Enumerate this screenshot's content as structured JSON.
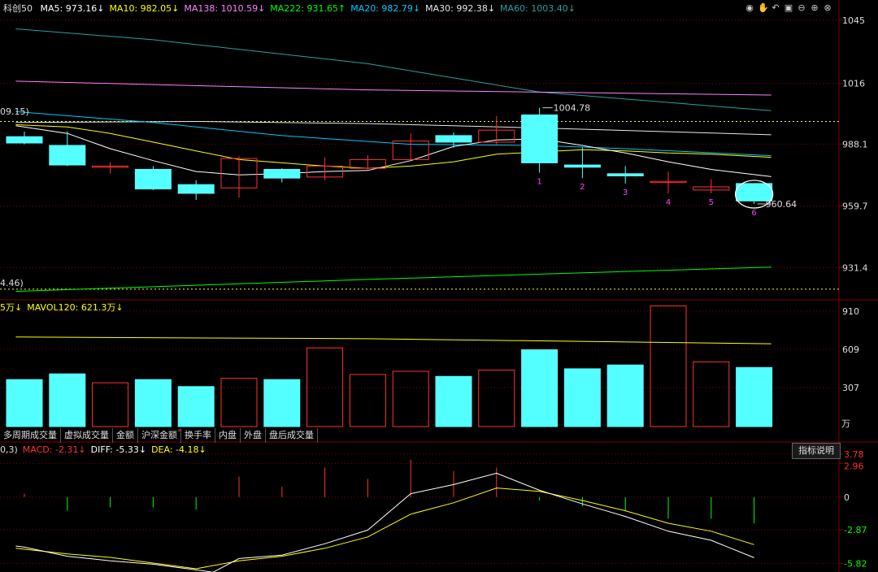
{
  "colors": {
    "up": "#ff3232",
    "down": "#54ffff",
    "ma5": "#ffffff",
    "ma10": "#ffff00",
    "ma138": "#ff80ff",
    "ma222": "#00ff00",
    "ma20": "#00c8ff",
    "ma30": "#e8e8e8",
    "ma60": "#2aa0a0",
    "mavol": "#ffff00",
    "diff": "#ffffff",
    "dea": "#ffff00",
    "grid": "#800000",
    "axis_text": "#dddddd"
  },
  "header": {
    "symbol": "科创50",
    "ma": [
      {
        "label": "MA5: 973.16↓",
        "color": "#ffffff"
      },
      {
        "label": "MA10: 982.05↓",
        "color": "#ffff00"
      },
      {
        "label": "MA138: 1010.59↓",
        "color": "#ff80ff"
      },
      {
        "label": "MA222: 931.65↑",
        "color": "#00ff00"
      },
      {
        "label": "MA20: 982.79↓",
        "color": "#00c8ff"
      },
      {
        "label": "MA30: 992.38↓",
        "color": "#e8e8e8"
      },
      {
        "label": "MA60: 1003.40↓",
        "color": "#2aa0a0"
      }
    ],
    "tool_icons": [
      "eye-icon",
      "hand-icon",
      "undo-icon",
      "lock-icon",
      "minus-icon",
      "plus-icon",
      "close-icon"
    ]
  },
  "price_panel": {
    "axis_ticks": [
      1045,
      1016,
      988.1,
      959.7,
      931.4
    ],
    "axis_labels": [
      "1045",
      "1016",
      "988.1",
      "959.7",
      "931.4"
    ],
    "left_edge_labels": [
      "09.15)",
      "4.46)"
    ],
    "high_marker": "1004.78",
    "low_marker": "960.64",
    "candle_numbers": [
      "1",
      "2",
      "3",
      "4",
      "5",
      "6"
    ]
  },
  "volume_panel": {
    "legend": [
      {
        "label": "5万↓",
        "color": "#ffff00"
      },
      {
        "label": "MAVOL120: 621.3万↓",
        "color": "#ffff00"
      }
    ],
    "axis_labels": [
      "910",
      "609",
      "307",
      "万"
    ]
  },
  "tabs": [
    "多周期成交量",
    "虚拟成交量",
    "金额",
    "沪深金额",
    "换手率",
    "内盘",
    "外盘",
    "盘后成交量"
  ],
  "indicator_button": "指标说明",
  "macd_panel": {
    "legend": [
      {
        "label": "0,3)",
        "color": "#dddddd"
      },
      {
        "label": "MACD: -2.31↓",
        "color": "#ff3232"
      },
      {
        "label": "DIFF: -5.33↓",
        "color": "#ffffff"
      },
      {
        "label": "DEA: -4.18↓",
        "color": "#ffff00"
      }
    ],
    "axis_labels": [
      {
        "text": "3.78",
        "color": "#ff3232",
        "value": 3.78
      },
      {
        "text": "2.96",
        "color": "#ff3232",
        "value": 2.96
      },
      {
        "text": "0",
        "color": "#dddddd",
        "value": 0
      },
      {
        "text": "-2.87",
        "color": "#00ff00",
        "value": -2.87
      },
      {
        "text": "-5.82",
        "color": "#00ff00",
        "value": -5.82
      }
    ]
  },
  "chart_data": {
    "type": "candlestick",
    "price_range": [
      917,
      1052
    ],
    "candles": [
      {
        "o": 991.5,
        "h": 993.8,
        "l": 988.0,
        "c": 988.6
      },
      {
        "o": 987.5,
        "h": 994.0,
        "l": 978.0,
        "c": 978.5
      },
      {
        "o": 978.0,
        "h": 979.8,
        "l": 974.5,
        "c": 978.0
      },
      {
        "o": 976.5,
        "h": 978.0,
        "l": 967.0,
        "c": 967.5
      },
      {
        "o": 969.5,
        "h": 971.5,
        "l": 962.5,
        "c": 965.5
      },
      {
        "o": 968.0,
        "h": 982.5,
        "l": 963.5,
        "c": 981.5
      },
      {
        "o": 976.5,
        "h": 977.0,
        "l": 970.5,
        "c": 972.5
      },
      {
        "o": 973.0,
        "h": 982.0,
        "l": 971.5,
        "c": 978.0
      },
      {
        "o": 977.0,
        "h": 983.0,
        "l": 976.5,
        "c": 981.0
      },
      {
        "o": 981.0,
        "h": 993.0,
        "l": 980.5,
        "c": 989.5
      },
      {
        "o": 992.0,
        "h": 993.5,
        "l": 986.5,
        "c": 989.0
      },
      {
        "o": 989.0,
        "h": 1001.0,
        "l": 988.0,
        "c": 994.5
      },
      {
        "o": 1001.5,
        "h": 1004.78,
        "l": 975.0,
        "c": 979.5
      },
      {
        "o": 978.5,
        "h": 986.5,
        "l": 972.5,
        "c": 977.5
      },
      {
        "o": 974.5,
        "h": 978.0,
        "l": 970.0,
        "c": 973.5
      },
      {
        "o": 971.0,
        "h": 975.5,
        "l": 965.5,
        "c": 971.0
      },
      {
        "o": 967.0,
        "h": 972.0,
        "l": 965.5,
        "c": 968.5
      },
      {
        "o": 970.0,
        "h": 970.0,
        "l": 960.64,
        "c": 962.0
      }
    ],
    "volume": {
      "range": [
        0,
        960
      ],
      "values": [
        370,
        415,
        345,
        370,
        315,
        380,
        370,
        620,
        410,
        435,
        395,
        445,
        605,
        455,
        485,
        950,
        510,
        465
      ],
      "mavol120": [
        {
          "i": -0.2,
          "v": 705
        },
        {
          "i": 8,
          "v": 692
        },
        {
          "i": 17.4,
          "v": 652
        }
      ]
    },
    "moving_averages": [
      {
        "name": "MA60",
        "color": "#2aa0a0",
        "pts": [
          {
            "i": -0.2,
            "v": 1041
          },
          {
            "i": 3,
            "v": 1036
          },
          {
            "i": 8,
            "v": 1025
          },
          {
            "i": 12,
            "v": 1012
          },
          {
            "i": 17.4,
            "v": 1003.4
          }
        ]
      },
      {
        "name": "MA138",
        "color": "#ff80ff",
        "pts": [
          {
            "i": -0.2,
            "v": 1017
          },
          {
            "i": 8,
            "v": 1013
          },
          {
            "i": 17.4,
            "v": 1010.59
          }
        ]
      },
      {
        "name": "MA30",
        "color": "#e8e8e8",
        "pts": [
          {
            "i": -0.2,
            "v": 998
          },
          {
            "i": 4,
            "v": 998.5
          },
          {
            "i": 8,
            "v": 997.5
          },
          {
            "i": 12,
            "v": 995.5
          },
          {
            "i": 17.4,
            "v": 992.38
          }
        ]
      },
      {
        "name": "MA20",
        "color": "#00c8ff",
        "pts": [
          {
            "i": -0.2,
            "v": 1003
          },
          {
            "i": 3,
            "v": 998
          },
          {
            "i": 6,
            "v": 992
          },
          {
            "i": 9,
            "v": 988
          },
          {
            "i": 12,
            "v": 987.5
          },
          {
            "i": 14,
            "v": 986
          },
          {
            "i": 17.4,
            "v": 982.79
          }
        ]
      },
      {
        "name": "MA10",
        "color": "#ffff00",
        "pts": [
          {
            "i": -0.2,
            "v": 997
          },
          {
            "i": 1,
            "v": 996
          },
          {
            "i": 2,
            "v": 993
          },
          {
            "i": 3,
            "v": 989
          },
          {
            "i": 4,
            "v": 985
          },
          {
            "i": 5,
            "v": 981
          },
          {
            "i": 6,
            "v": 979.5
          },
          {
            "i": 7,
            "v": 978
          },
          {
            "i": 8,
            "v": 977
          },
          {
            "i": 9,
            "v": 978
          },
          {
            "i": 10,
            "v": 980
          },
          {
            "i": 11,
            "v": 983.5
          },
          {
            "i": 12,
            "v": 984.5
          },
          {
            "i": 13,
            "v": 985.5
          },
          {
            "i": 14,
            "v": 985
          },
          {
            "i": 15,
            "v": 984
          },
          {
            "i": 16,
            "v": 983.5
          },
          {
            "i": 17.4,
            "v": 982.05
          }
        ]
      },
      {
        "name": "MA5",
        "color": "#ffffff",
        "pts": [
          {
            "i": -0.2,
            "v": 996.5
          },
          {
            "i": 1,
            "v": 993
          },
          {
            "i": 2,
            "v": 986
          },
          {
            "i": 3,
            "v": 980.5
          },
          {
            "i": 4,
            "v": 975.5
          },
          {
            "i": 5,
            "v": 974
          },
          {
            "i": 6,
            "v": 974.5
          },
          {
            "i": 7,
            "v": 975.5
          },
          {
            "i": 8,
            "v": 976
          },
          {
            "i": 9,
            "v": 980.5
          },
          {
            "i": 10,
            "v": 987
          },
          {
            "i": 11,
            "v": 990
          },
          {
            "i": 12,
            "v": 990.5
          },
          {
            "i": 13,
            "v": 987.5
          },
          {
            "i": 14,
            "v": 984
          },
          {
            "i": 15,
            "v": 980
          },
          {
            "i": 16,
            "v": 976.5
          },
          {
            "i": 17.4,
            "v": 973.16
          }
        ]
      },
      {
        "name": "MA222",
        "color": "#00ff00",
        "pts": [
          {
            "i": -0.2,
            "v": 920.5
          },
          {
            "i": 8,
            "v": 926
          },
          {
            "i": 17.4,
            "v": 931.65
          }
        ]
      }
    ],
    "dotted_levels": [
      998.5,
      921.5
    ],
    "macd": {
      "range": [
        -6.3,
        4.2
      ],
      "hist": [
        0.3,
        -1.2,
        -0.9,
        -0.9,
        -1.1,
        1.8,
        0.9,
        2.6,
        1.6,
        3.3,
        2.3,
        2.6,
        -0.3,
        -0.8,
        -1.2,
        -1.9,
        -1.9,
        -2.31
      ],
      "diff": [
        {
          "i": -0.2,
          "v": -4.3
        },
        {
          "i": 0,
          "v": -4.4
        },
        {
          "i": 1,
          "v": -5.2
        },
        {
          "i": 2,
          "v": -5.6
        },
        {
          "i": 3,
          "v": -5.9
        },
        {
          "i": 4,
          "v": -6.4
        },
        {
          "i": 4.4,
          "v": -6.6
        },
        {
          "i": 5,
          "v": -5.4
        },
        {
          "i": 6,
          "v": -5.1
        },
        {
          "i": 7,
          "v": -4.1
        },
        {
          "i": 8,
          "v": -2.9
        },
        {
          "i": 9,
          "v": 0.3
        },
        {
          "i": 10,
          "v": 1.1
        },
        {
          "i": 11,
          "v": 2.1
        },
        {
          "i": 12,
          "v": 0.6
        },
        {
          "i": 13,
          "v": -0.6
        },
        {
          "i": 14,
          "v": -1.7
        },
        {
          "i": 15,
          "v": -3.0
        },
        {
          "i": 16,
          "v": -3.8
        },
        {
          "i": 17,
          "v": -5.33
        }
      ],
      "dea": [
        {
          "i": -0.2,
          "v": -4.5
        },
        {
          "i": 1,
          "v": -5.0
        },
        {
          "i": 2,
          "v": -5.3
        },
        {
          "i": 3,
          "v": -5.8
        },
        {
          "i": 4,
          "v": -6.3
        },
        {
          "i": 5,
          "v": -5.6
        },
        {
          "i": 6,
          "v": -5.2
        },
        {
          "i": 7,
          "v": -4.5
        },
        {
          "i": 8,
          "v": -3.5
        },
        {
          "i": 9,
          "v": -1.5
        },
        {
          "i": 10,
          "v": -0.5
        },
        {
          "i": 11,
          "v": 0.8
        },
        {
          "i": 12,
          "v": 0.5
        },
        {
          "i": 13,
          "v": -0.3
        },
        {
          "i": 14,
          "v": -1.2
        },
        {
          "i": 15,
          "v": -2.3
        },
        {
          "i": 16,
          "v": -3.0
        },
        {
          "i": 17,
          "v": -4.18
        }
      ]
    }
  }
}
